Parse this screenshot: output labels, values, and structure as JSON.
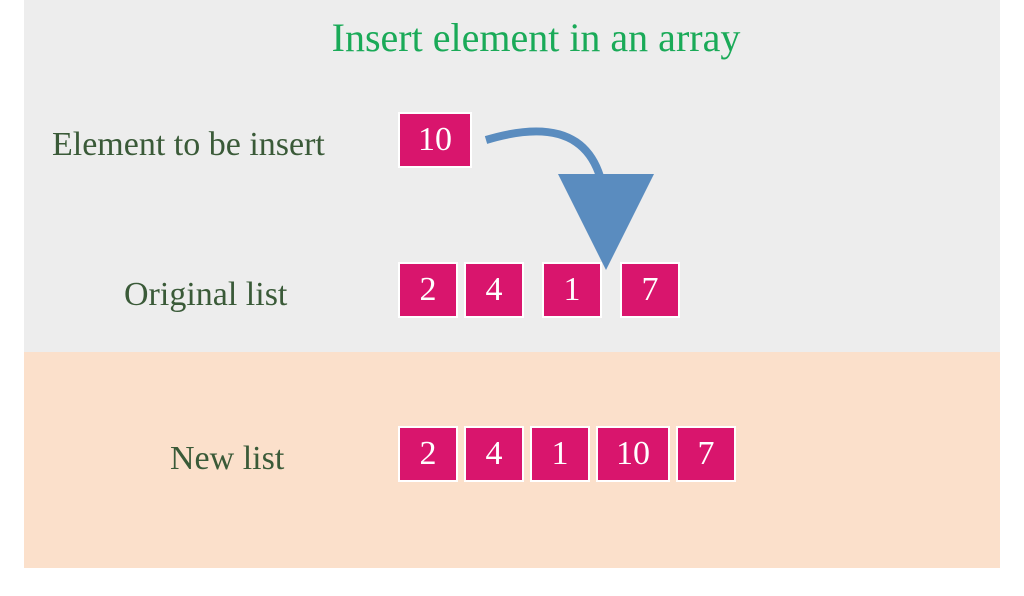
{
  "title": "Insert element in an array",
  "labels": {
    "insert": "Element to be insert",
    "original": "Original list",
    "newlist": "New list"
  },
  "insert_value": "10",
  "original": [
    "2",
    "4",
    "1",
    "7"
  ],
  "newlist": [
    "2",
    "4",
    "1",
    "10",
    "7"
  ],
  "colors": {
    "title": "#1aaa58",
    "label": "#3a5a38",
    "box_bg": "#d9156d",
    "box_fg": "#ffffff",
    "arrow": "#5a8cbf",
    "top_bg": "#ededed",
    "bottom_bg": "#fbe0cb"
  },
  "chart_data": {
    "type": "table",
    "description": "Diagram showing insertion of an element into an array at index 3",
    "element_to_insert": 10,
    "insert_index": 3,
    "original_array": [
      2,
      4,
      1,
      7
    ],
    "resulting_array": [
      2,
      4,
      1,
      10,
      7
    ]
  }
}
